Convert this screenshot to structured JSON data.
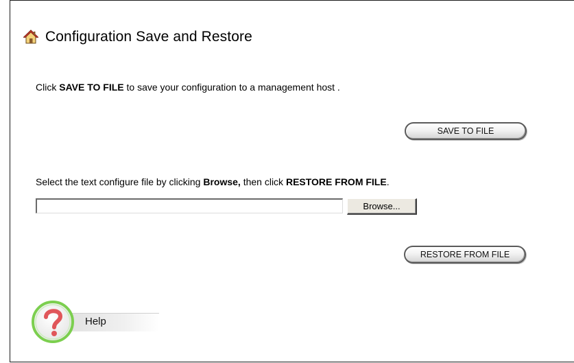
{
  "page": {
    "title": "Configuration Save and Restore"
  },
  "icons": {
    "title_icon": "home-icon",
    "help_icon": "help-question-icon"
  },
  "save_section": {
    "instruction_prefix": "Click ",
    "instruction_bold": "SAVE TO FILE",
    "instruction_suffix": " to save your configuration to a management host .",
    "button_label": "SAVE TO FILE"
  },
  "restore_section": {
    "instruction_prefix": "Select the text configure file by clicking ",
    "instruction_bold_browse": "Browse,",
    "instruction_middle": " then click ",
    "instruction_bold_restore": "RESTORE FROM FILE",
    "instruction_suffix": ".",
    "file_input_value": "",
    "browse_label": "Browse...",
    "button_label": "RESTORE FROM FILE"
  },
  "help": {
    "label": "Help"
  },
  "colors": {
    "help_ring": "#7ccf4f",
    "help_mark": "#e0565a",
    "home_roof": "#c0392b"
  }
}
